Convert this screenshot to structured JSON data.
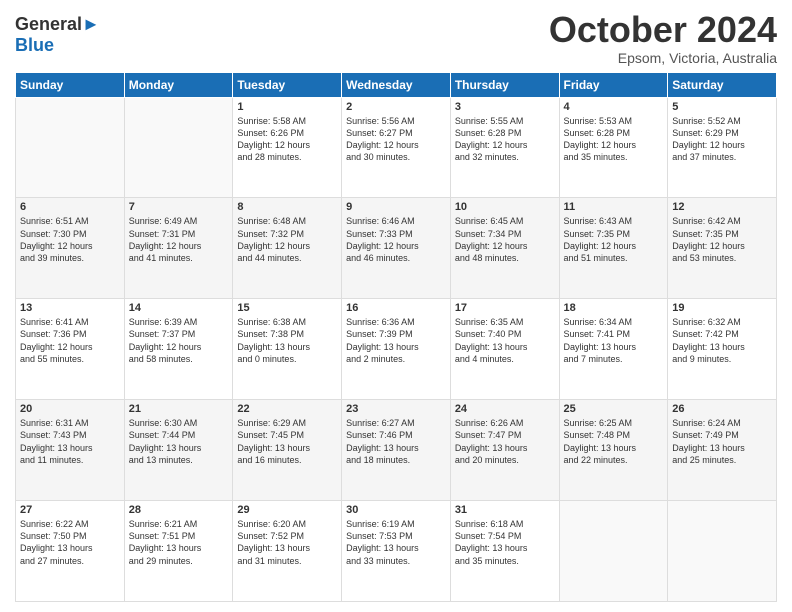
{
  "header": {
    "logo_line1": "General",
    "logo_line2": "Blue",
    "month": "October 2024",
    "location": "Epsom, Victoria, Australia"
  },
  "days": [
    "Sunday",
    "Monday",
    "Tuesday",
    "Wednesday",
    "Thursday",
    "Friday",
    "Saturday"
  ],
  "weeks": [
    [
      {
        "num": "",
        "text": ""
      },
      {
        "num": "",
        "text": ""
      },
      {
        "num": "1",
        "text": "Sunrise: 5:58 AM\nSunset: 6:26 PM\nDaylight: 12 hours\nand 28 minutes."
      },
      {
        "num": "2",
        "text": "Sunrise: 5:56 AM\nSunset: 6:27 PM\nDaylight: 12 hours\nand 30 minutes."
      },
      {
        "num": "3",
        "text": "Sunrise: 5:55 AM\nSunset: 6:28 PM\nDaylight: 12 hours\nand 32 minutes."
      },
      {
        "num": "4",
        "text": "Sunrise: 5:53 AM\nSunset: 6:28 PM\nDaylight: 12 hours\nand 35 minutes."
      },
      {
        "num": "5",
        "text": "Sunrise: 5:52 AM\nSunset: 6:29 PM\nDaylight: 12 hours\nand 37 minutes."
      }
    ],
    [
      {
        "num": "6",
        "text": "Sunrise: 6:51 AM\nSunset: 7:30 PM\nDaylight: 12 hours\nand 39 minutes."
      },
      {
        "num": "7",
        "text": "Sunrise: 6:49 AM\nSunset: 7:31 PM\nDaylight: 12 hours\nand 41 minutes."
      },
      {
        "num": "8",
        "text": "Sunrise: 6:48 AM\nSunset: 7:32 PM\nDaylight: 12 hours\nand 44 minutes."
      },
      {
        "num": "9",
        "text": "Sunrise: 6:46 AM\nSunset: 7:33 PM\nDaylight: 12 hours\nand 46 minutes."
      },
      {
        "num": "10",
        "text": "Sunrise: 6:45 AM\nSunset: 7:34 PM\nDaylight: 12 hours\nand 48 minutes."
      },
      {
        "num": "11",
        "text": "Sunrise: 6:43 AM\nSunset: 7:35 PM\nDaylight: 12 hours\nand 51 minutes."
      },
      {
        "num": "12",
        "text": "Sunrise: 6:42 AM\nSunset: 7:35 PM\nDaylight: 12 hours\nand 53 minutes."
      }
    ],
    [
      {
        "num": "13",
        "text": "Sunrise: 6:41 AM\nSunset: 7:36 PM\nDaylight: 12 hours\nand 55 minutes."
      },
      {
        "num": "14",
        "text": "Sunrise: 6:39 AM\nSunset: 7:37 PM\nDaylight: 12 hours\nand 58 minutes."
      },
      {
        "num": "15",
        "text": "Sunrise: 6:38 AM\nSunset: 7:38 PM\nDaylight: 13 hours\nand 0 minutes."
      },
      {
        "num": "16",
        "text": "Sunrise: 6:36 AM\nSunset: 7:39 PM\nDaylight: 13 hours\nand 2 minutes."
      },
      {
        "num": "17",
        "text": "Sunrise: 6:35 AM\nSunset: 7:40 PM\nDaylight: 13 hours\nand 4 minutes."
      },
      {
        "num": "18",
        "text": "Sunrise: 6:34 AM\nSunset: 7:41 PM\nDaylight: 13 hours\nand 7 minutes."
      },
      {
        "num": "19",
        "text": "Sunrise: 6:32 AM\nSunset: 7:42 PM\nDaylight: 13 hours\nand 9 minutes."
      }
    ],
    [
      {
        "num": "20",
        "text": "Sunrise: 6:31 AM\nSunset: 7:43 PM\nDaylight: 13 hours\nand 11 minutes."
      },
      {
        "num": "21",
        "text": "Sunrise: 6:30 AM\nSunset: 7:44 PM\nDaylight: 13 hours\nand 13 minutes."
      },
      {
        "num": "22",
        "text": "Sunrise: 6:29 AM\nSunset: 7:45 PM\nDaylight: 13 hours\nand 16 minutes."
      },
      {
        "num": "23",
        "text": "Sunrise: 6:27 AM\nSunset: 7:46 PM\nDaylight: 13 hours\nand 18 minutes."
      },
      {
        "num": "24",
        "text": "Sunrise: 6:26 AM\nSunset: 7:47 PM\nDaylight: 13 hours\nand 20 minutes."
      },
      {
        "num": "25",
        "text": "Sunrise: 6:25 AM\nSunset: 7:48 PM\nDaylight: 13 hours\nand 22 minutes."
      },
      {
        "num": "26",
        "text": "Sunrise: 6:24 AM\nSunset: 7:49 PM\nDaylight: 13 hours\nand 25 minutes."
      }
    ],
    [
      {
        "num": "27",
        "text": "Sunrise: 6:22 AM\nSunset: 7:50 PM\nDaylight: 13 hours\nand 27 minutes."
      },
      {
        "num": "28",
        "text": "Sunrise: 6:21 AM\nSunset: 7:51 PM\nDaylight: 13 hours\nand 29 minutes."
      },
      {
        "num": "29",
        "text": "Sunrise: 6:20 AM\nSunset: 7:52 PM\nDaylight: 13 hours\nand 31 minutes."
      },
      {
        "num": "30",
        "text": "Sunrise: 6:19 AM\nSunset: 7:53 PM\nDaylight: 13 hours\nand 33 minutes."
      },
      {
        "num": "31",
        "text": "Sunrise: 6:18 AM\nSunset: 7:54 PM\nDaylight: 13 hours\nand 35 minutes."
      },
      {
        "num": "",
        "text": ""
      },
      {
        "num": "",
        "text": ""
      }
    ]
  ]
}
